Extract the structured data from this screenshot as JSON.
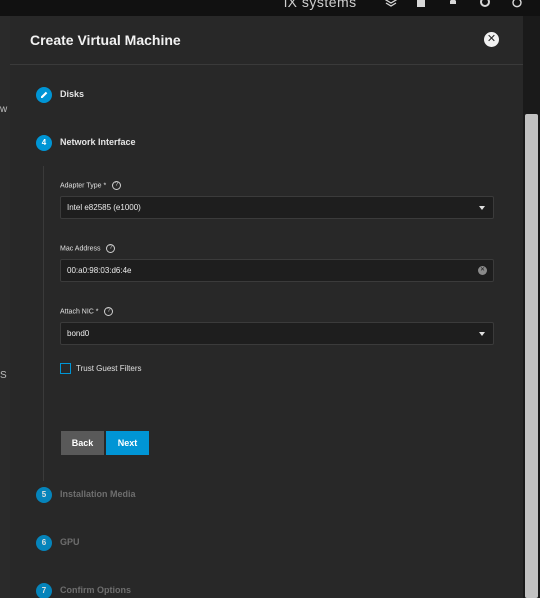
{
  "topbar": {
    "brand": "iX systems",
    "icons": [
      "layers-icon",
      "clipboard-icon",
      "bell-icon",
      "gear-icon",
      "power-icon"
    ]
  },
  "background": {
    "frag_w": "w",
    "frag_s": "S"
  },
  "dialog": {
    "title": "Create Virtual Machine",
    "close_icon": "close-icon"
  },
  "steps": [
    {
      "number": "",
      "label": "Disks",
      "state": "completed",
      "icon": "pencil-icon"
    },
    {
      "number": "4",
      "label": "Network Interface",
      "state": "active"
    },
    {
      "number": "5",
      "label": "Installation Media",
      "state": "inactive"
    },
    {
      "number": "6",
      "label": "GPU",
      "state": "inactive"
    },
    {
      "number": "7",
      "label": "Confirm Options",
      "state": "inactive"
    }
  ],
  "form": {
    "adapter_type": {
      "label": "Adapter Type *",
      "value": "Intel e82585 (e1000)"
    },
    "mac_address": {
      "label": "Mac Address",
      "value": "00:a0:98:03:d6:4e"
    },
    "attach_nic": {
      "label": "Attach NIC *",
      "value": "bond0"
    },
    "trust_guest_filters": {
      "label": "Trust Guest Filters",
      "checked": false
    }
  },
  "buttons": {
    "back": "Back",
    "next": "Next"
  },
  "colors": {
    "accent": "#0095d5",
    "dialog_bg": "#282828",
    "field_bg": "#1e1e1e"
  }
}
